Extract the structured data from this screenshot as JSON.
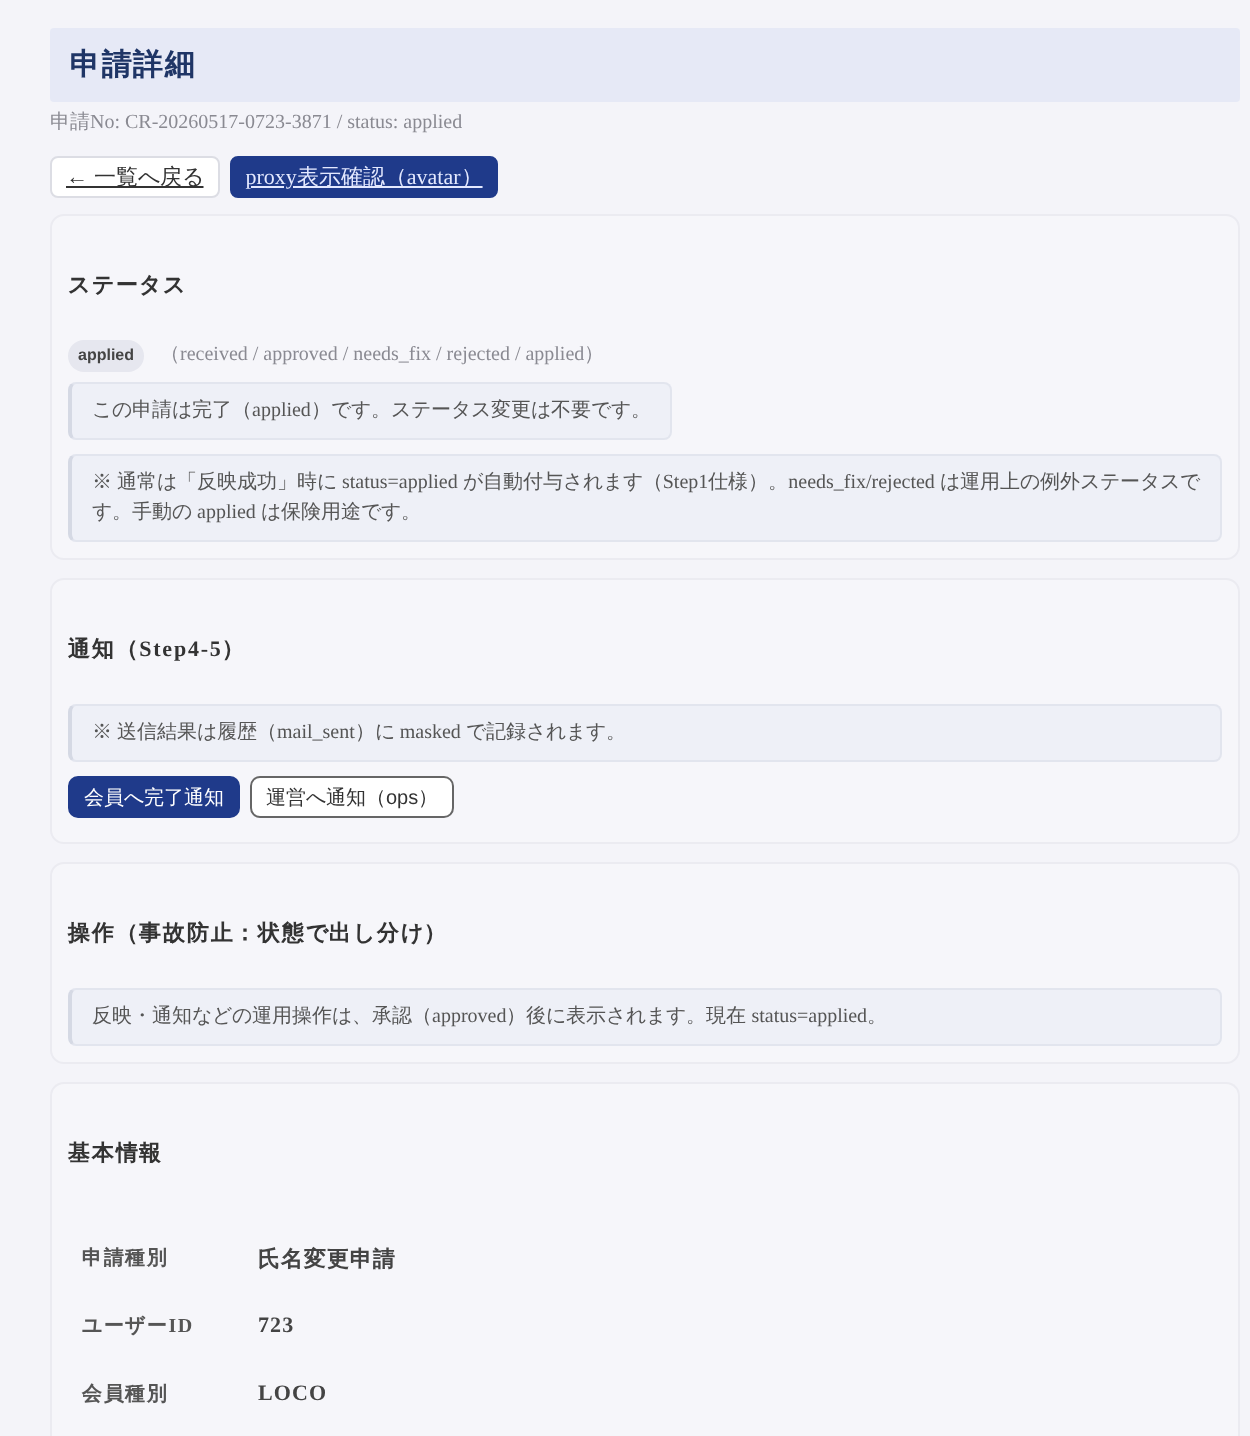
{
  "header": {
    "title": "申請詳細",
    "meta": "申請No: CR-20260517-0723-3871 / status: applied"
  },
  "top_actions": [
    {
      "label": "← 一覧へ戻る",
      "kind": "secondary"
    },
    {
      "label": "proxy表示確認（avatar）",
      "kind": "primary"
    }
  ],
  "sections": [
    {
      "title": "ステータス",
      "status": {
        "badge": "applied",
        "options": "（received / approved / needs_fix / rejected / applied）"
      },
      "notes": [
        {
          "kind": "message",
          "text": "この申請は完了（applied）です。ステータス変更は不要です。"
        },
        {
          "kind": "info",
          "text": "※ 通常は「反映成功」時に status=applied が自動付与されます（Step1仕様）。needs_fix/rejected は運用上の例外ステータスです。手動の applied は保険用途です。"
        }
      ]
    },
    {
      "title": "通知（Step4-5）",
      "notes": [
        {
          "kind": "info",
          "text": "※ 送信結果は履歴（mail_sent）に masked で記録されます。"
        }
      ],
      "buttons": [
        {
          "label": "会員へ完了通知",
          "kind": "primary"
        },
        {
          "label": "運営へ通知（ops）",
          "kind": "secondary"
        }
      ]
    },
    {
      "title": "操作（事故防止：状態で出し分け）",
      "notes": [
        {
          "kind": "info",
          "text": "反映・通知などの運用操作は、承認（approved）後に表示されます。現在 status=applied。"
        }
      ]
    },
    {
      "title": "基本情報",
      "fields": [
        {
          "label": "申請種別",
          "value": "氏名変更申請"
        },
        {
          "label": "ユーザーID",
          "value": "723"
        },
        {
          "label": "会員種別",
          "value": "LOCO"
        }
      ]
    }
  ]
}
